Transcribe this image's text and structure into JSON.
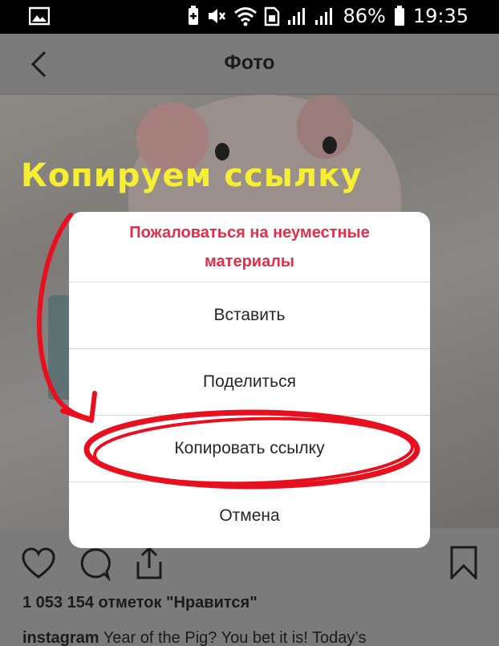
{
  "status_bar": {
    "battery": "86%",
    "time": "19:35",
    "icons": [
      "image-icon",
      "battery-saver-icon",
      "mute-icon",
      "wifi-icon",
      "sim-icon",
      "signal-icon",
      "signal-icon",
      "battery-icon"
    ]
  },
  "app_bar": {
    "title": "Фото",
    "back_icon": "chevron-left-icon"
  },
  "annotation": {
    "text": "Копируем ссылку",
    "text_color": "#f6ee35",
    "marker_color": "#e8101f"
  },
  "dialog": {
    "header": "Пожаловаться на неуместные материалы",
    "header_color": "#e0304a",
    "items": [
      {
        "label": "Вставить"
      },
      {
        "label": "Поделиться"
      },
      {
        "label": "Копировать ссылку"
      },
      {
        "label": "Отмена"
      }
    ]
  },
  "post": {
    "likes": "1 053 154 отметок \"Нравится\"",
    "caption_user": "instagram",
    "caption_text": "Year of the Pig? You bet it is! Today’s",
    "actions": [
      "heart-icon",
      "comment-icon",
      "share-icon",
      "bookmark-icon"
    ]
  }
}
